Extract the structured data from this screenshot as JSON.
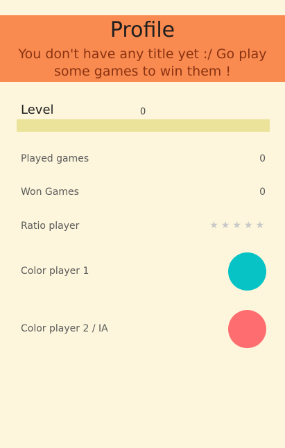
{
  "header": {
    "title": "Profile",
    "subtitle": "You don't have any title yet :/ Go play some games to win them !"
  },
  "level": {
    "label": "Level",
    "value": "0",
    "progress": 0
  },
  "stats": {
    "played_games": {
      "label": "Played games",
      "value": "0"
    },
    "won_games": {
      "label": "Won Games",
      "value": "0"
    },
    "ratio": {
      "label": "Ratio player",
      "stars_total": 5,
      "stars_filled": 0
    }
  },
  "colors": {
    "player1": {
      "label": "Color player 1",
      "color": "#08c3c5"
    },
    "player2": {
      "label": "Color player 2 / IA",
      "color": "#fe6e71"
    }
  },
  "theme": {
    "header_bg": "#f98b50",
    "page_bg": "#fdf6dc",
    "level_bar": "#ece39b"
  }
}
